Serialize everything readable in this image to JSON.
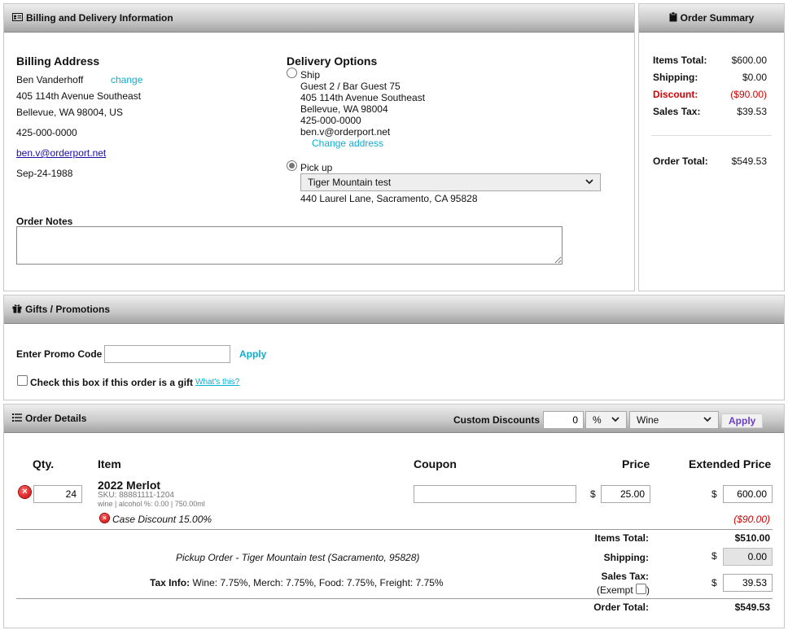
{
  "billing_panel": {
    "title": "Billing and Delivery Information",
    "billing": {
      "heading": "Billing Address",
      "name": "Ben Vanderhoff",
      "change_label": "change",
      "street": "405 114th Avenue Southeast",
      "city_line": "Bellevue, WA 98004, US",
      "phone": "425-000-0000",
      "email": "ben.v@orderport.net",
      "dob": "Sep-24-1988"
    },
    "delivery": {
      "heading": "Delivery Options",
      "ship_label": "Ship",
      "ship_name": "Guest 2 / Bar Guest 75",
      "ship_street": "405 114th Avenue Southeast",
      "ship_city": "Bellevue, WA 98004",
      "ship_phone": "425-000-0000",
      "ship_email": "ben.v@orderport.net",
      "change_address_label": "Change address",
      "pickup_label": "Pick up",
      "pickup_location": "Tiger Mountain test",
      "pickup_address": "440 Laurel Lane, Sacramento, CA 95828",
      "selected": "pickup"
    },
    "notes_label": "Order Notes",
    "notes_value": ""
  },
  "summary_panel": {
    "title": "Order Summary",
    "items_total_label": "Items Total:",
    "items_total": "$600.00",
    "shipping_label": "Shipping:",
    "shipping": "$0.00",
    "discount_label": "Discount:",
    "discount": "($90.00)",
    "sales_tax_label": "Sales Tax:",
    "sales_tax": "$39.53",
    "order_total_label": "Order Total:",
    "order_total": "$549.53"
  },
  "gifts_panel": {
    "title": "Gifts / Promotions",
    "promo_label": "Enter Promo Code",
    "promo_value": "",
    "apply_label": "Apply",
    "gift_checkbox_label": "Check this box if this order is a gift",
    "whats_this": "What's this?"
  },
  "details_panel": {
    "title": "Order Details",
    "custom_discounts_label": "Custom Discounts",
    "custom_discount_value": "0",
    "discount_type": "%",
    "discount_category": "Wine",
    "apply_label": "Apply",
    "columns": {
      "qty": "Qty.",
      "item": "Item",
      "coupon": "Coupon",
      "price": "Price",
      "extended": "Extended Price"
    },
    "line": {
      "qty": "24",
      "name": "2022 Merlot",
      "sku": "SKU: 88881111-1204",
      "meta": "wine | alcohol %: 0.00 | 750.00ml",
      "coupon": "",
      "currency": "$",
      "price": "25.00",
      "extended": "600.00",
      "discount_label": "Case Discount 15.00%",
      "discount_amount": "($90.00)"
    },
    "totals": {
      "items_total_label": "Items Total:",
      "items_total": "$510.00",
      "shipping_label": "Shipping:",
      "shipping_value": "0.00",
      "sales_tax_label": "Sales Tax:",
      "exempt_label": "(Exempt",
      "exempt_close": ")",
      "sales_tax_value": "39.53",
      "order_total_label": "Order Total:",
      "order_total": "$549.53",
      "currency": "$"
    },
    "pickup_note": "Pickup Order - Tiger Mountain test (Sacramento, 95828)",
    "tax_info_label": "Tax Info:",
    "tax_info": " Wine: 7.75%, Merch: 7.75%, Food: 7.75%, Freight: 7.75%"
  },
  "icons": {
    "billing": "id-card-icon",
    "summary": "clipboard-icon",
    "gifts": "gift-icon",
    "details": "list-icon",
    "remove": "remove-circle-icon",
    "dropdown": "chevron-down-icon"
  }
}
